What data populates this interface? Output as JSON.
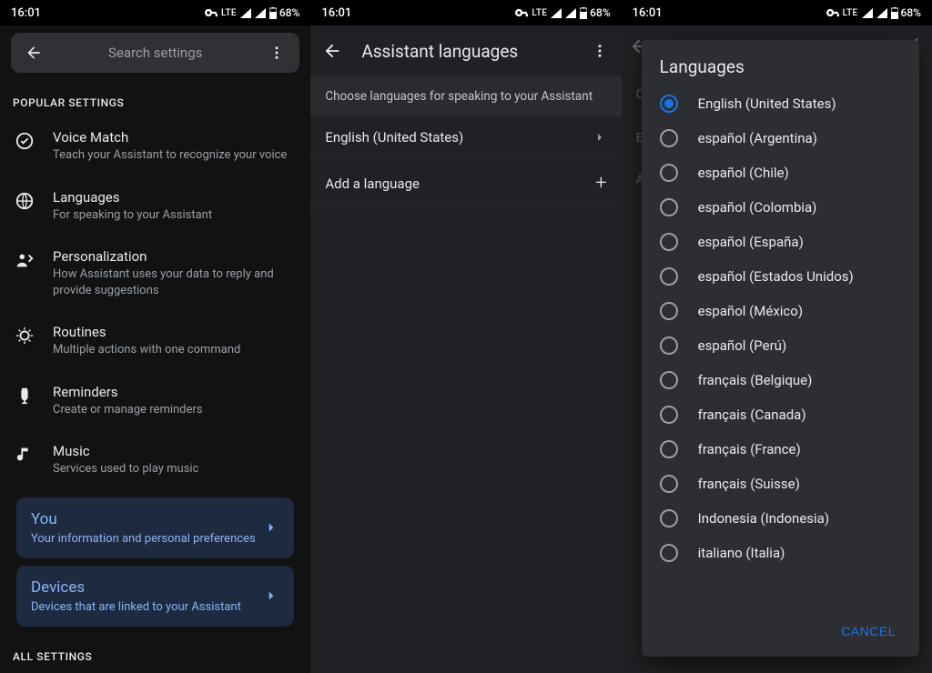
{
  "status": {
    "time": "16:01",
    "network": "LTE",
    "battery": "68%",
    "vpn_icon": "vpn-key-icon"
  },
  "screen1": {
    "search_placeholder": "Search settings",
    "section_popular": "POPULAR SETTINGS",
    "section_all": "ALL SETTINGS",
    "items": [
      {
        "title": "Voice Match",
        "sub": "Teach your Assistant to recognize your voice"
      },
      {
        "title": "Languages",
        "sub": "For speaking to your Assistant"
      },
      {
        "title": "Personalization",
        "sub": "How Assistant uses your data to reply and provide suggestions"
      },
      {
        "title": "Routines",
        "sub": "Multiple actions with one command"
      },
      {
        "title": "Reminders",
        "sub": "Create or manage reminders"
      },
      {
        "title": "Music",
        "sub": "Services used to play music"
      }
    ],
    "cards": [
      {
        "title": "You",
        "sub": "Your information and personal preferences"
      },
      {
        "title": "Devices",
        "sub": "Devices that are linked to your Assistant"
      }
    ]
  },
  "screen2": {
    "title": "Assistant languages",
    "header": "Choose languages for speaking to your Assistant",
    "current_language": "English (United States)",
    "add_label": "Add a language"
  },
  "screen3": {
    "bg_hints": {
      "c": "C",
      "e": "E",
      "a": "A"
    },
    "dialog": {
      "title": "Languages",
      "selected_index": 0,
      "options": [
        "English (United States)",
        "español (Argentina)",
        "español (Chile)",
        "español (Colombia)",
        "español (España)",
        "español (Estados Unidos)",
        "español (México)",
        "español (Perú)",
        "français (Belgique)",
        "français (Canada)",
        "français (France)",
        "français (Suisse)",
        "Indonesia (Indonesia)",
        "italiano (Italia)"
      ],
      "cancel": "CANCEL"
    }
  }
}
